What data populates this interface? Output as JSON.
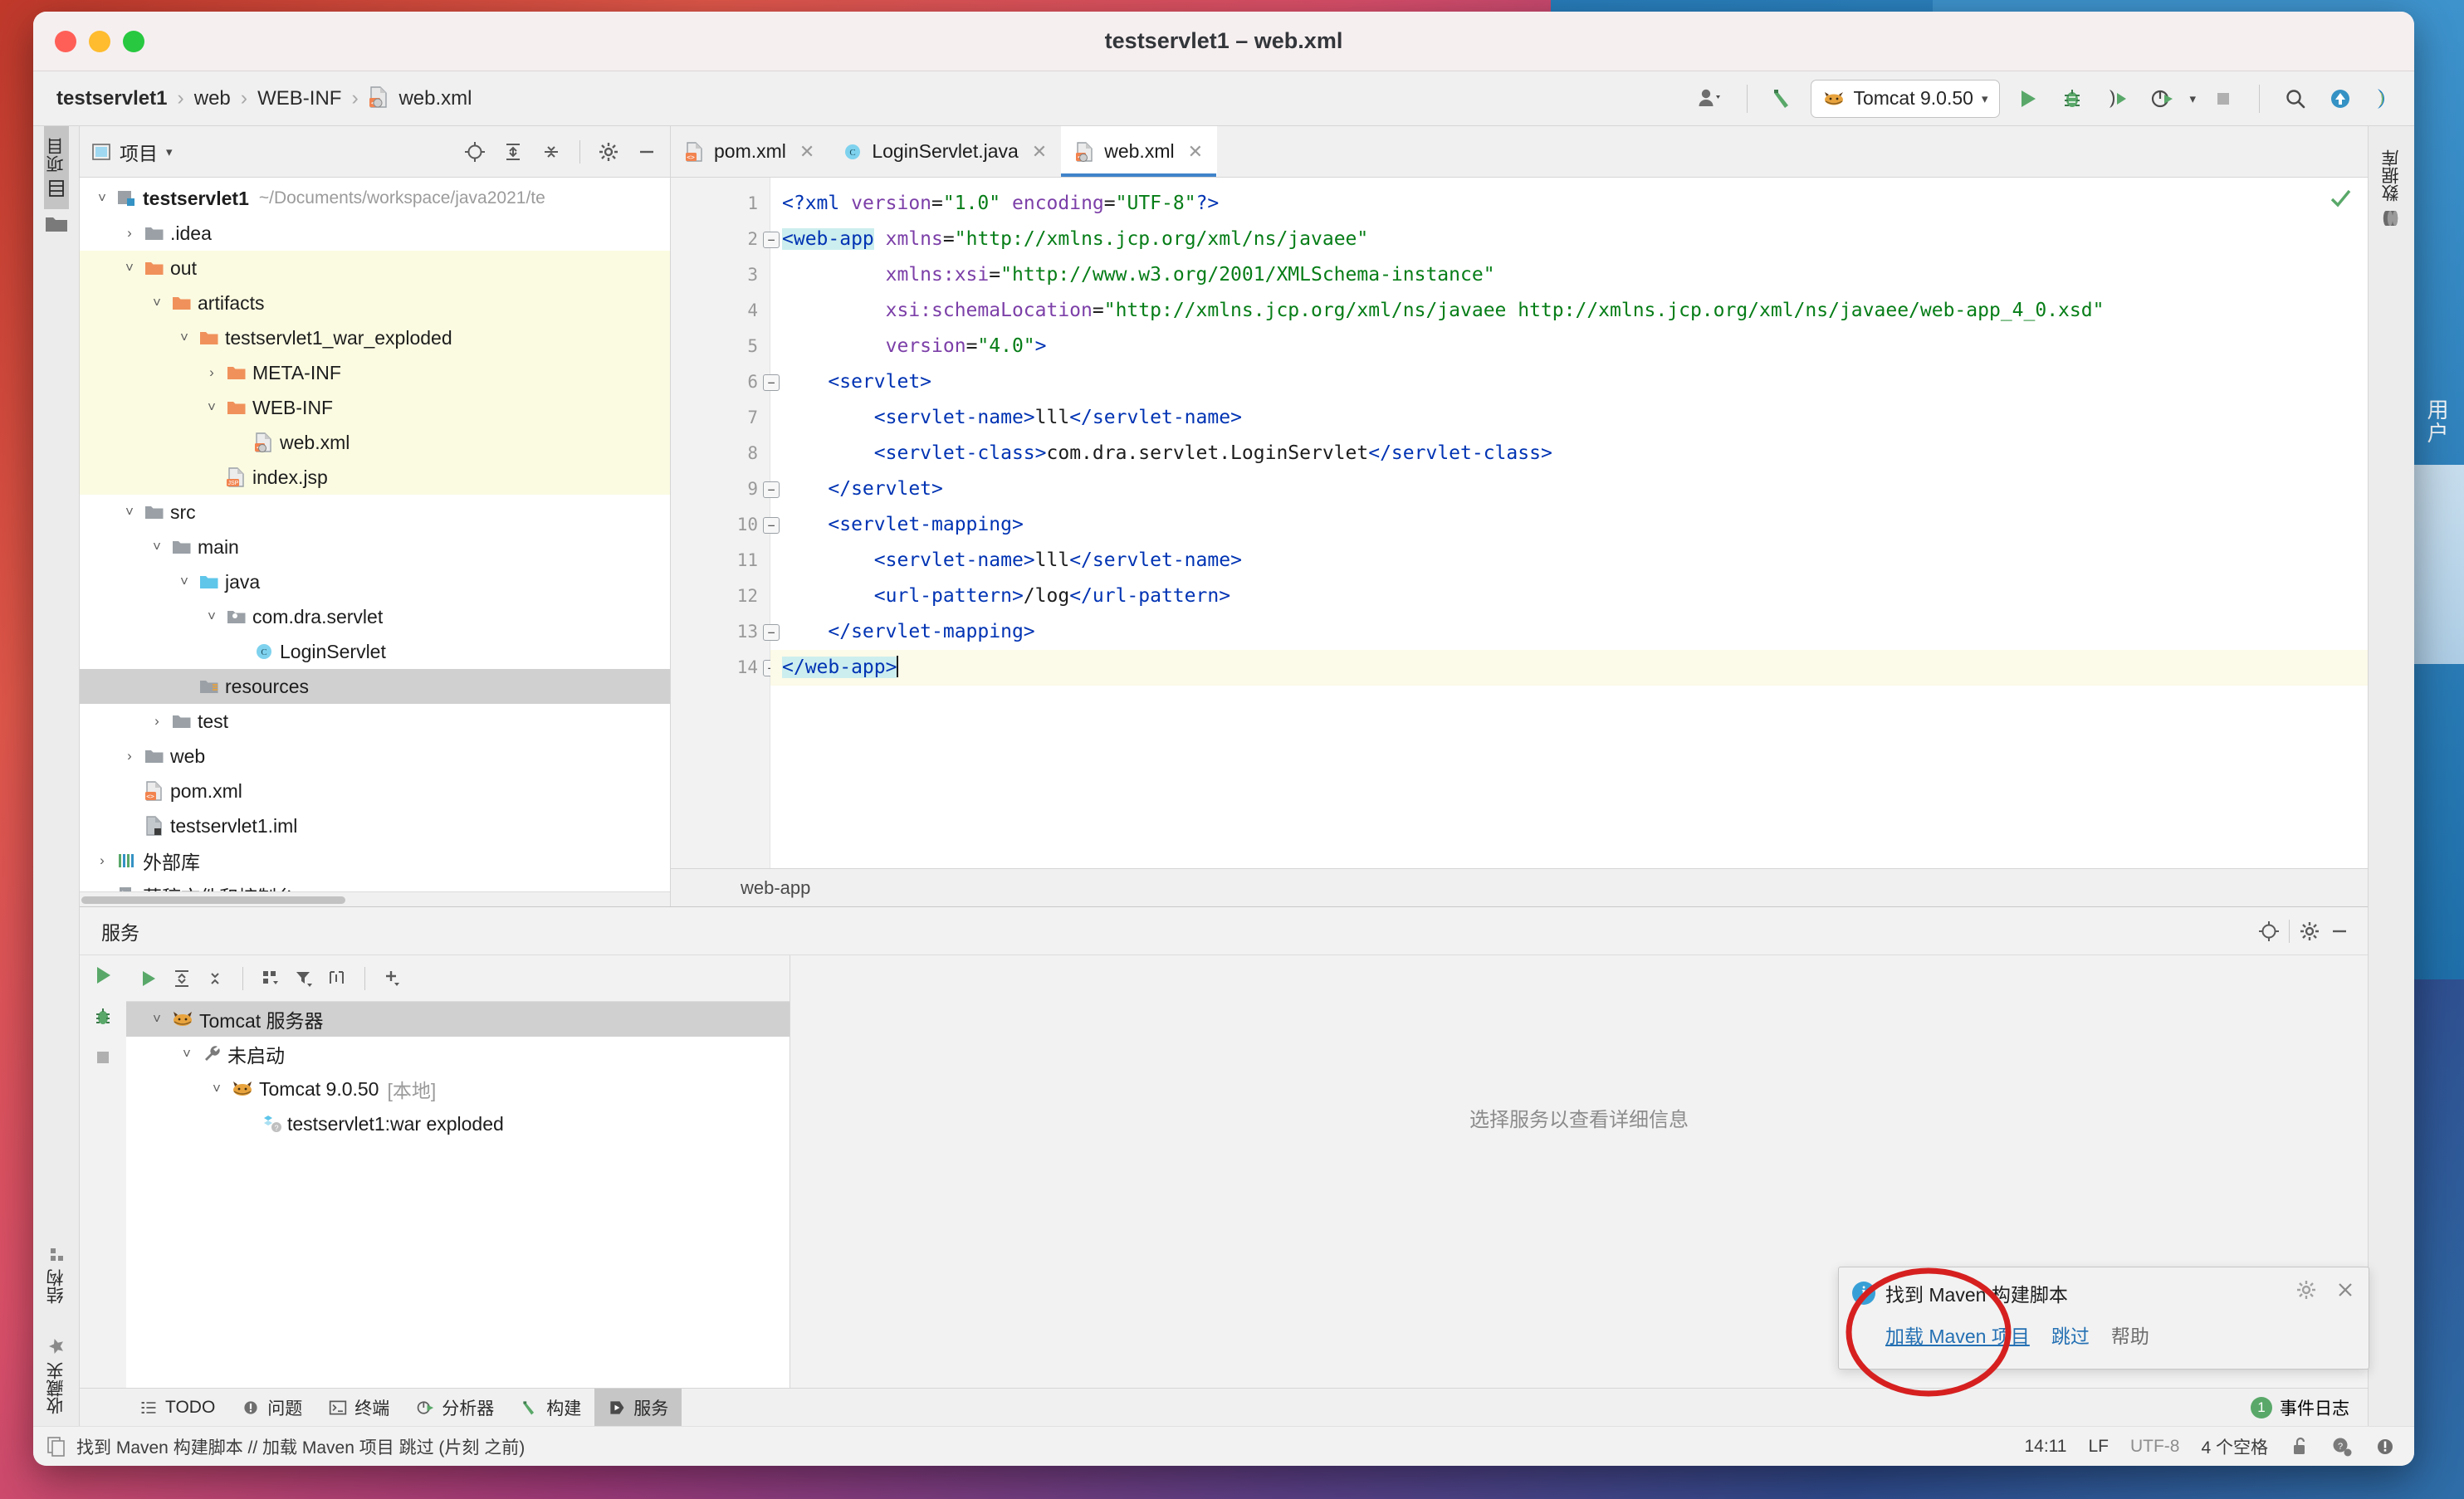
{
  "window": {
    "title": "testservlet1 – web.xml",
    "traffic_lights": [
      "close",
      "minimize",
      "zoom"
    ]
  },
  "breadcrumb": {
    "items": [
      {
        "label": "testservlet1",
        "icon": "project-icon",
        "bold": true
      },
      {
        "label": "web",
        "icon": "",
        "bold": false
      },
      {
        "label": "WEB-INF",
        "icon": "",
        "bold": false
      },
      {
        "label": "web.xml",
        "icon": "xml-file-icon",
        "bold": false
      }
    ],
    "separator": "›"
  },
  "toolbar": {
    "user_icon": "user-avatar-icon",
    "build_icon": "build-hammer-icon",
    "run_config": {
      "label": "Tomcat 9.0.50",
      "icon": "tomcat-icon",
      "caret": "▾"
    },
    "run_icon": "run-play-icon",
    "debug_icon": "debug-bug-icon",
    "run_coverage_icon": "run-with-coverage-icon",
    "profile_icon": "profiler-icon",
    "profile_caret": "▾",
    "stop_icon": "stop-icon",
    "search_icon": "search-everywhere-icon",
    "update_icon": "update-project-icon",
    "ide_icon": "intellij-logo-icon"
  },
  "left_strip": {
    "top": [
      {
        "label": "项目",
        "icon": "project-tool-icon",
        "active": true
      }
    ],
    "bottom": [
      {
        "label": "结构",
        "icon": "structure-icon",
        "active": false
      },
      {
        "label": "收藏夹",
        "icon": "favorites-star-icon",
        "active": false
      }
    ]
  },
  "right_strip": {
    "items": [
      {
        "label": "数据库",
        "icon": "database-icon",
        "active": false
      }
    ]
  },
  "project_panel": {
    "title": "项目",
    "title_icon": "project-view-icon",
    "title_caret": "▾",
    "header_buttons": [
      {
        "name": "locate-icon"
      },
      {
        "name": "expand-all-icon"
      },
      {
        "name": "collapse-all-icon"
      },
      {
        "name": "gear-icon"
      },
      {
        "name": "minimize-icon"
      }
    ],
    "tree": [
      {
        "indent": 0,
        "arrow": "˅",
        "icon": "module-icon",
        "label": "testservlet1",
        "bold": true,
        "path": "~/Documents/workspace/java2021/te",
        "highlight": false,
        "selected": false
      },
      {
        "indent": 1,
        "arrow": "›",
        "icon": "folder-grey-icon",
        "label": ".idea",
        "bold": false,
        "path": "",
        "highlight": false,
        "selected": false
      },
      {
        "indent": 1,
        "arrow": "˅",
        "icon": "folder-orange-icon",
        "label": "out",
        "bold": false,
        "path": "",
        "highlight": true,
        "selected": false
      },
      {
        "indent": 2,
        "arrow": "˅",
        "icon": "folder-orange-icon",
        "label": "artifacts",
        "bold": false,
        "path": "",
        "highlight": true,
        "selected": false
      },
      {
        "indent": 3,
        "arrow": "˅",
        "icon": "folder-orange-icon",
        "label": "testservlet1_war_exploded",
        "bold": false,
        "path": "",
        "highlight": true,
        "selected": false
      },
      {
        "indent": 4,
        "arrow": "›",
        "icon": "folder-orange-icon",
        "label": "META-INF",
        "bold": false,
        "path": "",
        "highlight": true,
        "selected": false
      },
      {
        "indent": 4,
        "arrow": "˅",
        "icon": "folder-orange-icon",
        "label": "WEB-INF",
        "bold": false,
        "path": "",
        "highlight": true,
        "selected": false
      },
      {
        "indent": 5,
        "arrow": "",
        "icon": "xml-file-icon",
        "label": "web.xml",
        "bold": false,
        "path": "",
        "highlight": true,
        "selected": false
      },
      {
        "indent": 4,
        "arrow": "",
        "icon": "jsp-file-icon",
        "label": "index.jsp",
        "bold": false,
        "path": "",
        "highlight": true,
        "selected": false
      },
      {
        "indent": 1,
        "arrow": "˅",
        "icon": "folder-grey-icon",
        "label": "src",
        "bold": false,
        "path": "",
        "highlight": false,
        "selected": false
      },
      {
        "indent": 2,
        "arrow": "˅",
        "icon": "folder-grey-icon",
        "label": "main",
        "bold": false,
        "path": "",
        "highlight": false,
        "selected": false
      },
      {
        "indent": 3,
        "arrow": "˅",
        "icon": "folder-blue-icon",
        "label": "java",
        "bold": false,
        "path": "",
        "highlight": false,
        "selected": false
      },
      {
        "indent": 4,
        "arrow": "˅",
        "icon": "package-icon",
        "label": "com.dra.servlet",
        "bold": false,
        "path": "",
        "highlight": false,
        "selected": false
      },
      {
        "indent": 5,
        "arrow": "",
        "icon": "class-icon",
        "label": "LoginServlet",
        "bold": false,
        "path": "",
        "highlight": false,
        "selected": false
      },
      {
        "indent": 3,
        "arrow": "",
        "icon": "resources-folder-icon",
        "label": "resources",
        "bold": false,
        "path": "",
        "highlight": false,
        "selected": true
      },
      {
        "indent": 2,
        "arrow": "›",
        "icon": "folder-grey-icon",
        "label": "test",
        "bold": false,
        "path": "",
        "highlight": false,
        "selected": false
      },
      {
        "indent": 1,
        "arrow": "›",
        "icon": "folder-grey-icon",
        "label": "web",
        "bold": false,
        "path": "",
        "highlight": false,
        "selected": false
      },
      {
        "indent": 1,
        "arrow": "",
        "icon": "maven-pom-icon",
        "label": "pom.xml",
        "bold": false,
        "path": "",
        "highlight": false,
        "selected": false
      },
      {
        "indent": 1,
        "arrow": "",
        "icon": "iml-file-icon",
        "label": "testservlet1.iml",
        "bold": false,
        "path": "",
        "highlight": false,
        "selected": false
      },
      {
        "indent": 0,
        "arrow": "›",
        "icon": "external-libraries-icon",
        "label": "外部库",
        "bold": false,
        "path": "",
        "highlight": false,
        "selected": false
      },
      {
        "indent": 0,
        "arrow": "›",
        "icon": "scratches-icon",
        "label": "草稿文件和控制台",
        "bold": false,
        "path": "",
        "highlight": false,
        "selected": false
      }
    ]
  },
  "editor": {
    "tabs": [
      {
        "label": "pom.xml",
        "icon": "maven-pom-icon",
        "active": false,
        "close": "✕"
      },
      {
        "label": "LoginServlet.java",
        "icon": "class-icon",
        "active": false,
        "close": "✕"
      },
      {
        "label": "web.xml",
        "icon": "xml-file-icon",
        "active": true,
        "close": "✕"
      }
    ],
    "breadcrumb_bottom": "web-app",
    "inspection_status": "ok",
    "line_numbers": [
      1,
      2,
      3,
      4,
      5,
      6,
      7,
      8,
      9,
      10,
      11,
      12,
      13,
      14
    ],
    "current_line": 14,
    "lines": [
      {
        "n": 1,
        "fold": false,
        "segments": [
          {
            "t": "<?",
            "c": "tag"
          },
          {
            "t": "xml ",
            "c": "tag"
          },
          {
            "t": "version",
            "c": "attr"
          },
          {
            "t": "=",
            "c": "txt"
          },
          {
            "t": "\"1.0\"",
            "c": "str"
          },
          {
            "t": " ",
            "c": "txt"
          },
          {
            "t": "encoding",
            "c": "attr"
          },
          {
            "t": "=",
            "c": "txt"
          },
          {
            "t": "\"UTF-8\"",
            "c": "str"
          },
          {
            "t": "?>",
            "c": "tag"
          }
        ]
      },
      {
        "n": 2,
        "fold": true,
        "segments": [
          {
            "t": "<web-app",
            "c": "tag hlbox"
          },
          {
            "t": " ",
            "c": "txt"
          },
          {
            "t": "xmlns",
            "c": "attr"
          },
          {
            "t": "=",
            "c": "txt"
          },
          {
            "t": "\"http://xmlns.jcp.org/xml/ns/javaee\"",
            "c": "str"
          }
        ]
      },
      {
        "n": 3,
        "fold": false,
        "segments": [
          {
            "t": "         ",
            "c": "txt"
          },
          {
            "t": "xmlns:xsi",
            "c": "attr"
          },
          {
            "t": "=",
            "c": "txt"
          },
          {
            "t": "\"http://www.w3.org/2001/XMLSchema-instance\"",
            "c": "str"
          }
        ]
      },
      {
        "n": 4,
        "fold": false,
        "segments": [
          {
            "t": "         ",
            "c": "txt"
          },
          {
            "t": "xsi:schemaLocation",
            "c": "attr"
          },
          {
            "t": "=",
            "c": "txt"
          },
          {
            "t": "\"http://xmlns.jcp.org/xml/ns/javaee http://xmlns.jcp.org/xml/ns/javaee/web-app_4_0.xsd\"",
            "c": "str"
          }
        ]
      },
      {
        "n": 5,
        "fold": false,
        "segments": [
          {
            "t": "         ",
            "c": "txt"
          },
          {
            "t": "version",
            "c": "attr"
          },
          {
            "t": "=",
            "c": "txt"
          },
          {
            "t": "\"4.0\"",
            "c": "str"
          },
          {
            "t": ">",
            "c": "tag"
          }
        ]
      },
      {
        "n": 6,
        "fold": true,
        "segments": [
          {
            "t": "    ",
            "c": "txt"
          },
          {
            "t": "<servlet>",
            "c": "tag"
          }
        ]
      },
      {
        "n": 7,
        "fold": false,
        "segments": [
          {
            "t": "        ",
            "c": "txt"
          },
          {
            "t": "<servlet-name>",
            "c": "tag"
          },
          {
            "t": "lll",
            "c": "txt"
          },
          {
            "t": "</servlet-name>",
            "c": "tag"
          }
        ]
      },
      {
        "n": 8,
        "fold": false,
        "segments": [
          {
            "t": "        ",
            "c": "txt"
          },
          {
            "t": "<servlet-class>",
            "c": "tag"
          },
          {
            "t": "com.dra.servlet.LoginServlet",
            "c": "txt"
          },
          {
            "t": "</servlet-class>",
            "c": "tag"
          }
        ]
      },
      {
        "n": 9,
        "fold": true,
        "segments": [
          {
            "t": "    ",
            "c": "txt"
          },
          {
            "t": "</servlet>",
            "c": "tag"
          }
        ]
      },
      {
        "n": 10,
        "fold": true,
        "segments": [
          {
            "t": "    ",
            "c": "txt"
          },
          {
            "t": "<servlet-mapping>",
            "c": "tag"
          }
        ]
      },
      {
        "n": 11,
        "fold": false,
        "segments": [
          {
            "t": "        ",
            "c": "txt"
          },
          {
            "t": "<servlet-name>",
            "c": "tag"
          },
          {
            "t": "lll",
            "c": "txt"
          },
          {
            "t": "</servlet-name>",
            "c": "tag"
          }
        ]
      },
      {
        "n": 12,
        "fold": false,
        "segments": [
          {
            "t": "        ",
            "c": "txt"
          },
          {
            "t": "<url-pattern>",
            "c": "tag"
          },
          {
            "t": "/log",
            "c": "txt"
          },
          {
            "t": "</url-pattern>",
            "c": "tag"
          }
        ]
      },
      {
        "n": 13,
        "fold": true,
        "segments": [
          {
            "t": "    ",
            "c": "txt"
          },
          {
            "t": "</servlet-mapping>",
            "c": "tag"
          }
        ]
      },
      {
        "n": 14,
        "fold": true,
        "segments": [
          {
            "t": "</web-app>",
            "c": "tag hlbox"
          }
        ]
      }
    ]
  },
  "services": {
    "title": "服务",
    "header_buttons": [
      {
        "name": "locate-icon"
      },
      {
        "name": "gear-icon"
      },
      {
        "name": "minimize-icon"
      }
    ],
    "rail_buttons": [
      {
        "name": "run-play-icon"
      },
      {
        "name": "debug-bug-icon"
      },
      {
        "name": "stop-icon"
      }
    ],
    "toolbar_buttons": [
      {
        "name": "run-play-icon"
      },
      {
        "name": "expand-all-icon"
      },
      {
        "name": "collapse-all-icon"
      },
      {
        "name": "group-by-icon"
      },
      {
        "name": "filter-icon"
      },
      {
        "name": "show-configurations-icon"
      },
      {
        "name": "add-icon"
      }
    ],
    "tree": [
      {
        "indent": 0,
        "arrow": "˅",
        "icon": "tomcat-icon",
        "label": "Tomcat 服务器",
        "suffix": "",
        "selected": true
      },
      {
        "indent": 1,
        "arrow": "˅",
        "icon": "wrench-icon",
        "label": "未启动",
        "suffix": "",
        "selected": false
      },
      {
        "indent": 2,
        "arrow": "˅",
        "icon": "tomcat-icon",
        "label": "Tomcat 9.0.50",
        "suffix": "[本地]",
        "selected": false
      },
      {
        "indent": 3,
        "arrow": "",
        "icon": "artifact-icon",
        "label": "testservlet1:war exploded",
        "suffix": "",
        "selected": false
      }
    ],
    "empty_message": "选择服务以查看详细信息"
  },
  "bottom_tabs": [
    {
      "label": "TODO",
      "icon": "todo-icon",
      "active": false
    },
    {
      "label": "问题",
      "icon": "problems-icon",
      "active": false
    },
    {
      "label": "终端",
      "icon": "terminal-icon",
      "active": false
    },
    {
      "label": "分析器",
      "icon": "profiler-icon",
      "active": false
    },
    {
      "label": "构建",
      "icon": "build-hammer-icon",
      "active": false
    },
    {
      "label": "服务",
      "icon": "services-icon",
      "active": true
    }
  ],
  "event_log": {
    "count": "1",
    "label": "事件日志"
  },
  "status_bar": {
    "message": "找到 Maven 构建脚本 // 加载 Maven 项目  跳过 (片刻 之前)",
    "message_icon": "copy-icon",
    "time": "14:11",
    "line_separator": "LF",
    "encoding": "UTF-8",
    "indent": "4 个空格",
    "lock_icon": "unlocked-icon",
    "help_icon": "help-settings-icon",
    "inspection_icon": "inspection-icon"
  },
  "notification": {
    "icon": "info-icon",
    "title": "找到 Maven 构建脚本",
    "primary_action": "加载 Maven 项目",
    "secondary_action": "跳过",
    "help_action": "帮助",
    "gear_icon": "gear-icon",
    "close_icon": "close-icon"
  },
  "annotation": {
    "shape": "red-ellipse",
    "color": "#d62020"
  },
  "desktop": {
    "text": "用户"
  },
  "colors": {
    "accent": "#4083c9",
    "tag": "#0033b3",
    "attr": "#7c3fa8",
    "string": "#067d17",
    "highlight_row": "#fbfbe2",
    "selected_row": "#d0d0d0",
    "green_run": "#59a869",
    "link": "#2470b3"
  }
}
